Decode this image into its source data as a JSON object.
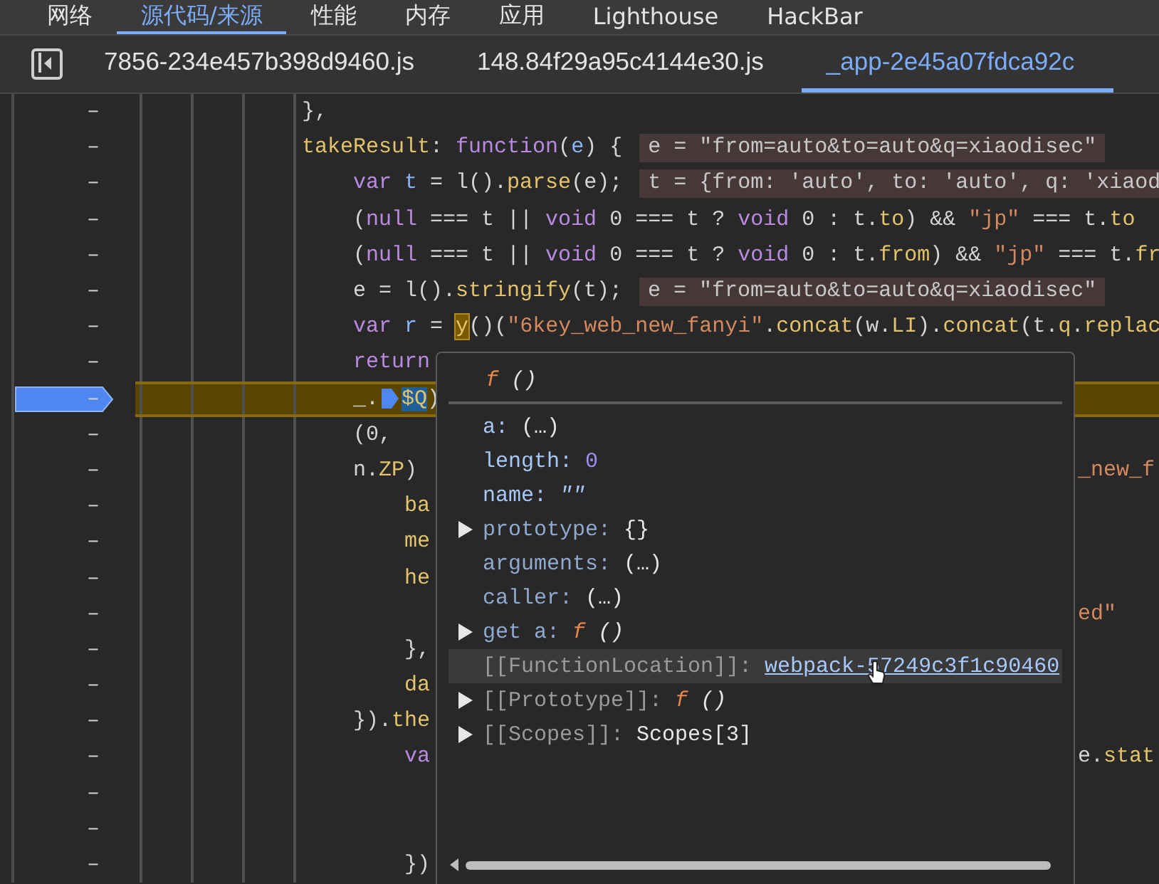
{
  "panel_tabs": [
    {
      "label": "网络",
      "selected": false
    },
    {
      "label": "源代码/来源",
      "selected": true
    },
    {
      "label": "性能",
      "selected": false
    },
    {
      "label": "内存",
      "selected": false
    },
    {
      "label": "应用",
      "selected": false
    },
    {
      "label": "Lighthouse",
      "selected": false
    },
    {
      "label": "HackBar",
      "selected": false
    }
  ],
  "file_tabs": [
    {
      "label": "7856-234e457b398d9460.js",
      "selected": false
    },
    {
      "label": "148.84f29a95c4144e30.js",
      "selected": false
    },
    {
      "label": "_app-2e45a07fdca92c",
      "selected": true
    }
  ],
  "lines": [
    {
      "number": "–",
      "paused": false,
      "segments": [
        {
          "kind": "code",
          "tokens": [
            {
              "kind": "plain",
              "s": "},"
            }
          ]
        }
      ]
    },
    {
      "number": "–",
      "paused": false,
      "segments": [
        {
          "kind": "code",
          "tokens": [
            {
              "kind": "property",
              "s": "takeResult"
            },
            {
              "kind": "plain",
              "s": ": "
            },
            {
              "kind": "keyword",
              "s": "function"
            },
            {
              "kind": "plain",
              "s": "("
            },
            {
              "kind": "variable",
              "s": "e"
            },
            {
              "kind": "plain",
              "s": ") {"
            }
          ]
        },
        {
          "kind": "inline_value",
          "text": "e = \"from=auto&to=auto&q=xiaodisec\""
        }
      ],
      "children": [
        {
          "number": "–",
          "paused": false,
          "segments": [
            {
              "kind": "code",
              "tokens": [
                {
                  "kind": "keyword",
                  "s": "var "
                },
                {
                  "kind": "variable",
                  "s": "t"
                },
                {
                  "kind": "plain",
                  "s": " = l()."
                },
                {
                  "kind": "property",
                  "s": "parse"
                },
                {
                  "kind": "plain",
                  "s": "(e);"
                }
              ]
            },
            {
              "kind": "inline_value",
              "text": "t = {from: 'auto', to: 'auto', q: 'xiaod"
            }
          ]
        },
        {
          "number": "–",
          "paused": false,
          "segments": [
            {
              "kind": "code",
              "tokens": [
                {
                  "kind": "plain",
                  "s": "("
                },
                {
                  "kind": "keyword",
                  "s": "null"
                },
                {
                  "kind": "plain",
                  "s": " === t || "
                },
                {
                  "kind": "keyword",
                  "s": "void"
                },
                {
                  "kind": "plain",
                  "s": " 0 === t ? "
                },
                {
                  "kind": "keyword",
                  "s": "void"
                },
                {
                  "kind": "plain",
                  "s": " 0 : t."
                },
                {
                  "kind": "property",
                  "s": "to"
                },
                {
                  "kind": "plain",
                  "s": ") && "
                },
                {
                  "kind": "string",
                  "s": "\"jp\""
                },
                {
                  "kind": "plain",
                  "s": " === t."
                },
                {
                  "kind": "property",
                  "s": "to"
                }
              ]
            }
          ]
        },
        {
          "number": "–",
          "paused": false,
          "segments": [
            {
              "kind": "code",
              "tokens": [
                {
                  "kind": "plain",
                  "s": "("
                },
                {
                  "kind": "keyword",
                  "s": "null"
                },
                {
                  "kind": "plain",
                  "s": " === t || "
                },
                {
                  "kind": "keyword",
                  "s": "void"
                },
                {
                  "kind": "plain",
                  "s": " 0 === t ? "
                },
                {
                  "kind": "keyword",
                  "s": "void"
                },
                {
                  "kind": "plain",
                  "s": " 0 : t."
                },
                {
                  "kind": "property",
                  "s": "from"
                },
                {
                  "kind": "plain",
                  "s": ") && "
                },
                {
                  "kind": "string",
                  "s": "\"jp\""
                },
                {
                  "kind": "plain",
                  "s": " === t."
                },
                {
                  "kind": "property",
                  "s": "fr"
                }
              ]
            }
          ]
        },
        {
          "number": "–",
          "paused": false,
          "segments": [
            {
              "kind": "code",
              "tokens": [
                {
                  "kind": "plain",
                  "s": "e = l()."
                },
                {
                  "kind": "property",
                  "s": "stringify"
                },
                {
                  "kind": "plain",
                  "s": "(t);"
                }
              ]
            },
            {
              "kind": "inline_value",
              "text": "e = \"from=auto&to=auto&q=xiaodisec\""
            }
          ]
        },
        {
          "number": "–",
          "paused": false,
          "segments": [
            {
              "kind": "code",
              "tokens": [
                {
                  "kind": "keyword",
                  "s": "var "
                },
                {
                  "kind": "variable",
                  "s": "r"
                },
                {
                  "kind": "plain",
                  "s": " = "
                },
                {
                  "kind": "hover",
                  "s": "y"
                },
                {
                  "kind": "plain",
                  "s": "()("
                },
                {
                  "kind": "string",
                  "s": "\"6key_web_new_fanyi\""
                },
                {
                  "kind": "plain",
                  "s": "."
                },
                {
                  "kind": "property",
                  "s": "concat"
                },
                {
                  "kind": "plain",
                  "s": "(w."
                },
                {
                  "kind": "property",
                  "s": "LI"
                },
                {
                  "kind": "plain",
                  "s": ")."
                },
                {
                  "kind": "property",
                  "s": "concat"
                },
                {
                  "kind": "plain",
                  "s": "(t."
                },
                {
                  "kind": "property",
                  "s": "q"
                },
                {
                  "kind": "plain",
                  "s": "."
                },
                {
                  "kind": "property",
                  "s": "replac"
                }
              ]
            }
          ]
        },
        {
          "number": "–",
          "paused": false,
          "segments": [
            {
              "kind": "code",
              "tokens": [
                {
                  "kind": "keyword",
                  "s": "return"
                }
              ]
            }
          ]
        },
        {
          "number": "–",
          "paused": true,
          "segments": [
            {
              "kind": "code",
              "tokens": [
                {
                  "kind": "plain",
                  "s": "_."
                }
              ]
            },
            {
              "kind": "step_icon"
            },
            {
              "kind": "code",
              "tokens": [
                {
                  "kind": "selection",
                  "s": "$Q"
                },
                {
                  "kind": "plain",
                  "s": ")"
                }
              ]
            }
          ]
        },
        {
          "number": "–",
          "paused": false,
          "segments": [
            {
              "kind": "code",
              "tokens": [
                {
                  "kind": "plain",
                  "s": "(0,"
                }
              ]
            }
          ]
        },
        {
          "number": "–",
          "paused": false,
          "segments": [
            {
              "kind": "code",
              "tokens": [
                {
                  "kind": "plain",
                  "s": "n."
                },
                {
                  "kind": "property",
                  "s": "ZP"
                },
                {
                  "kind": "plain",
                  "s": ")"
                }
              ]
            }
          ],
          "tail": [
            {
              "kind": "string",
              "s": "_new_f"
            }
          ],
          "children": [
            {
              "number": "–",
              "paused": false,
              "segments": [
                {
                  "kind": "code",
                  "tokens": [
                    {
                      "kind": "property",
                      "s": "ba"
                    }
                  ]
                }
              ]
            },
            {
              "number": "–",
              "paused": false,
              "segments": [
                {
                  "kind": "code",
                  "tokens": [
                    {
                      "kind": "property",
                      "s": "me"
                    }
                  ]
                }
              ]
            },
            {
              "number": "–",
              "paused": false,
              "segments": [
                {
                  "kind": "code",
                  "tokens": [
                    {
                      "kind": "property",
                      "s": "he"
                    }
                  ]
                }
              ]
            },
            {
              "number": "–",
              "paused": false,
              "tail": [
                {
                  "kind": "string",
                  "s": "ed\""
                }
              ]
            },
            {
              "number": "–",
              "paused": false,
              "segments": [
                {
                  "kind": "code",
                  "tokens": [
                    {
                      "kind": "plain",
                      "s": "},"
                    }
                  ]
                }
              ]
            },
            {
              "number": "–",
              "paused": false,
              "segments": [
                {
                  "kind": "code",
                  "tokens": [
                    {
                      "kind": "property",
                      "s": "da"
                    }
                  ]
                }
              ]
            }
          ]
        },
        {
          "number": "–",
          "paused": false,
          "segments": [
            {
              "kind": "code",
              "tokens": [
                {
                  "kind": "plain",
                  "s": "})."
                },
                {
                  "kind": "property",
                  "s": "the"
                }
              ]
            }
          ],
          "children": [
            {
              "number": "–",
              "paused": false,
              "segments": [
                {
                  "kind": "code",
                  "tokens": [
                    {
                      "kind": "keyword",
                      "s": "va"
                    }
                  ]
                }
              ],
              "tail": [
                {
                  "kind": "plain",
                  "s": "e."
                },
                {
                  "kind": "property",
                  "s": "stat"
                }
              ]
            },
            {
              "number": "–",
              "paused": false
            },
            {
              "number": "–",
              "paused": false
            },
            {
              "number": "–",
              "paused": false,
              "segments": [
                {
                  "kind": "code",
                  "tokens": [
                    {
                      "kind": "plain",
                      "s": "})"
                    }
                  ]
                }
              ]
            }
          ]
        }
      ]
    }
  ],
  "popover": {
    "header": {
      "func_mark": "f",
      "text": "()"
    },
    "entries": [
      {
        "key": "a:",
        "kind": "own",
        "value": {
          "kind": "plain",
          "text": "(…)"
        },
        "expandable": false,
        "hovered": false
      },
      {
        "key": "length:",
        "kind": "own",
        "value": {
          "kind": "number",
          "text": "0"
        },
        "expandable": false,
        "hovered": false
      },
      {
        "key": "name:",
        "kind": "own",
        "value": {
          "kind": "string",
          "text": "\"\""
        },
        "expandable": false,
        "hovered": false
      },
      {
        "key": "prototype:",
        "kind": "proto",
        "value": {
          "kind": "plain",
          "text": "{}"
        },
        "expandable": true,
        "hovered": false
      },
      {
        "key": "arguments:",
        "kind": "proto",
        "value": {
          "kind": "plain",
          "text": "(…)"
        },
        "expandable": false,
        "hovered": false
      },
      {
        "key": "caller:",
        "kind": "proto",
        "value": {
          "kind": "plain",
          "text": "(…)"
        },
        "expandable": false,
        "hovered": false
      },
      {
        "key": "get a:",
        "kind": "proto",
        "value": {
          "kind": "function",
          "func_mark": "f",
          "text": "()"
        },
        "expandable": true,
        "hovered": false
      },
      {
        "key": "[[FunctionLocation]]:",
        "kind": "internal",
        "value": {
          "kind": "link",
          "text": "webpack-57249c3f1c90460"
        },
        "expandable": false,
        "hovered": true
      },
      {
        "key": "[[Prototype]]:",
        "kind": "internal",
        "value": {
          "kind": "function",
          "func_mark": "f",
          "text": "()"
        },
        "expandable": true,
        "hovered": false
      },
      {
        "key": "[[Scopes]]:",
        "kind": "internal",
        "value": {
          "kind": "plain",
          "text": "Scopes[3]"
        },
        "expandable": true,
        "hovered": false
      }
    ]
  }
}
